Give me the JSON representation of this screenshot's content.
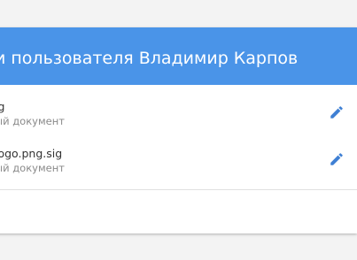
{
  "header": {
    "title": "и пользователя Владимир Карпов"
  },
  "files": [
    {
      "name": "ig",
      "type": "ый документ"
    },
    {
      "name": "logo.png.sig",
      "type": "ый документ"
    }
  ],
  "colors": {
    "header_bg": "#4a94e8",
    "edit_icon": "#3f80d4"
  },
  "icons": {
    "edit": "pencil-icon"
  }
}
